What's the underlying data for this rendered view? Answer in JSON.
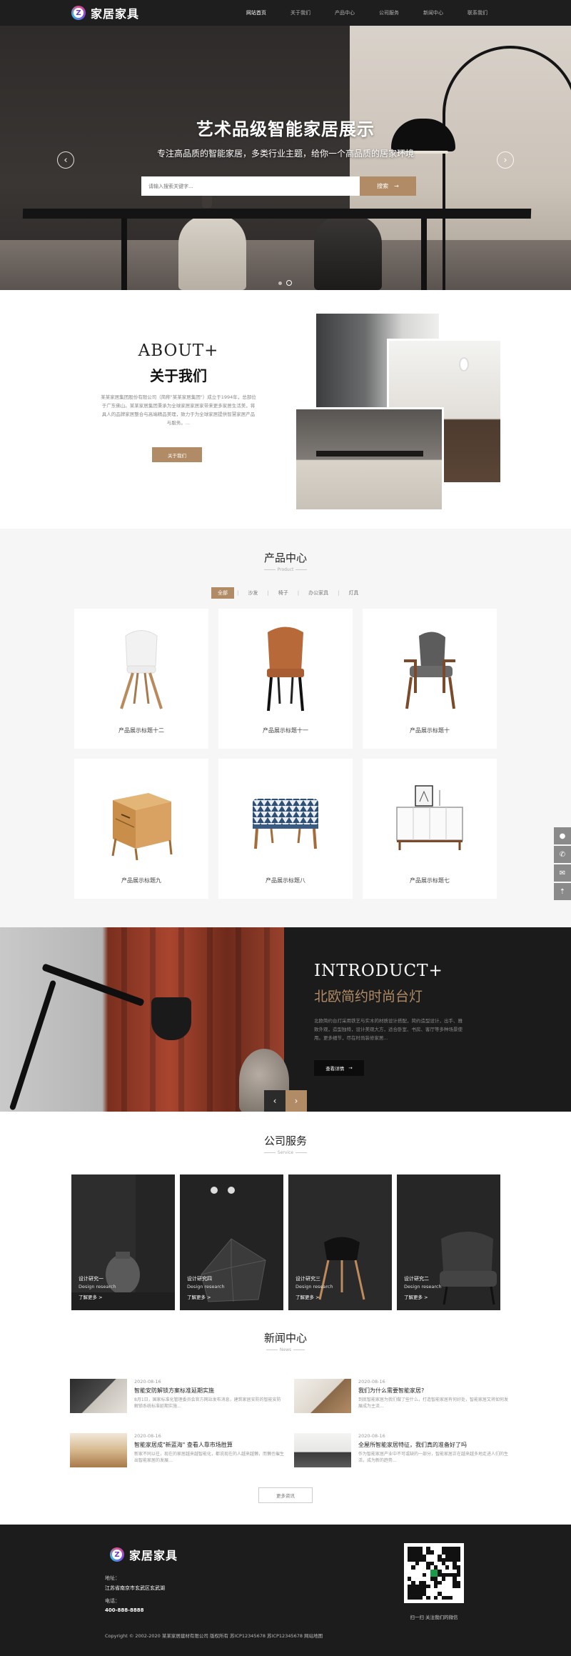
{
  "header": {
    "logo_text": "家居家具",
    "logo_letter": "Z",
    "nav": [
      "网站首页",
      "关于我们",
      "产品中心",
      "公司服务",
      "新闻中心",
      "联系我们"
    ]
  },
  "hero": {
    "title": "艺术品级智能家居展示",
    "subtitle": "专注高品质的智能家居，多类行业主题，给你一个高品质的居家环境",
    "search_placeholder": "请输入搜索关键字...",
    "search_button": "搜索",
    "search_arrow": "→",
    "prev": "‹",
    "next": "›"
  },
  "about": {
    "title_en": "ABOUT+",
    "title_cn": "关于我们",
    "text": "某某家居集团股份有限公司（简称\"某某家居集团\"）成立于1994年，总部位于广东佛山。某某家居集团秉承为全球家居家居家带来更多家居生活美，将具人的品牌家居整合与高端精品美理，致力于为全球家居提供智慧家居产品与服务。...",
    "button": "关于我们"
  },
  "products": {
    "title": "产品中心",
    "title_en": "Product",
    "tabs": [
      "全部",
      "沙发",
      "椅子",
      "办公家具",
      "灯具"
    ],
    "items": [
      {
        "name": "产品展示标题十二"
      },
      {
        "name": "产品展示标题十一"
      },
      {
        "name": "产品展示标题十"
      },
      {
        "name": "产品展示标题九"
      },
      {
        "name": "产品展示标题八"
      },
      {
        "name": "产品展示标题七"
      }
    ]
  },
  "intro": {
    "title_en": "INTRODUCT+",
    "title_cn": "北欧简约时尚台灯",
    "text": "北欧简约台灯采用铁艺与实木的材质设计搭配，简约造型设计，出手、雅致外观，造型独特，设计美观大方，适合卧室、书房、客厅等多种场景使用。更多细节，尽在时尚装修家居...",
    "button": "查看详情",
    "button_arrow": "→",
    "prev": "‹",
    "next": "›"
  },
  "services": {
    "title": "公司服务",
    "title_en": "Service",
    "items": [
      {
        "title": "设计研究一",
        "en": "Design research",
        "link": "了解更多 >"
      },
      {
        "title": "设计研究四",
        "en": "Design research",
        "link": "了解更多 >"
      },
      {
        "title": "设计研究三",
        "en": "Design research",
        "link": "了解更多 >"
      },
      {
        "title": "设计研究二",
        "en": "Design research",
        "link": "了解更多 >"
      }
    ]
  },
  "news": {
    "title": "新闻中心",
    "title_en": "News",
    "items": [
      {
        "date": "2020-08-16",
        "title": "智能安防解锁方案标准延期实施",
        "desc": "8月1日，国家标准化管理委员会官方网站发布消息，建筑家居安防的智能安防解锁系统标准延期实施..."
      },
      {
        "date": "2020-08-16",
        "title": "我们为什么需要智能家居?",
        "desc": "到底智能家居为我们做了些什么，打造智能家居有何好处，智能家居又将如何发展成为主流..."
      },
      {
        "date": "2020-08-16",
        "title": "智能家居成\"新蓝海\" 查看人靠市场胜算",
        "desc": "新家不同以往，现在的家居越来越智能化，都说现在的人越来越懒，而懒也催生出智能家居的发展..."
      },
      {
        "date": "2020-08-16",
        "title": "全屋所智能家居特征，我们真的准备好了吗",
        "desc": "作为智能家居产业中不可或缺的一部分，智能家居正在越来越多地走进人们的生活，成为新的趋势..."
      }
    ],
    "more_button": "更多资讯"
  },
  "footer": {
    "logo_text": "家居家具",
    "logo_letter": "Z",
    "address_label": "地址：",
    "address": "江苏省南京市玄武区玄武湖",
    "phone_label": "电话：",
    "phone": "400-888-8888",
    "copyright": "Copyright © 2002-2020 某某家居建材有限公司 版权所有 苏ICP12345678 苏ICP12345678 网站地图",
    "qr_caption": "扫一扫 关注我们的微信"
  },
  "float_icons": [
    "qq-icon",
    "phone-icon",
    "wechat-icon",
    "back-top-icon"
  ],
  "colors": {
    "accent": "#b08b65",
    "header_bg": "#1e1e1e",
    "footer_bg": "#1c1c1c",
    "section_bg": "#f6f6f6"
  }
}
